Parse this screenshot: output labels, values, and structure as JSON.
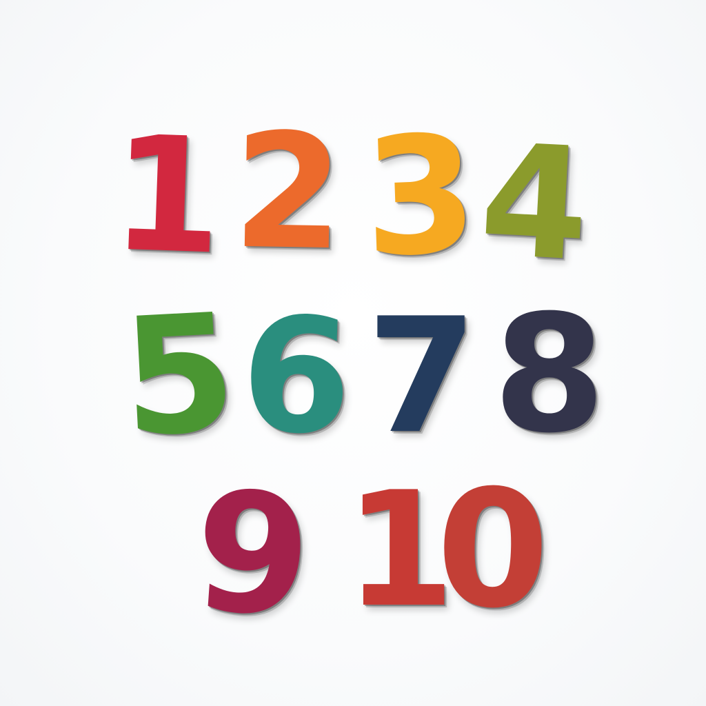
{
  "numbers": [
    {
      "text": "1",
      "color": "#d2283f"
    },
    {
      "text": "2",
      "color": "#ec6a2c"
    },
    {
      "text": "3",
      "color": "#f6a921"
    },
    {
      "text": "4",
      "color": "#8b9b2c"
    },
    {
      "text": "5",
      "color": "#4a9632"
    },
    {
      "text": "6",
      "color": "#2a8e7e"
    },
    {
      "text": "7",
      "color": "#243c5e"
    },
    {
      "text": "8",
      "color": "#33344b"
    },
    {
      "text": "9",
      "color": "#a3214b"
    },
    {
      "text": "1",
      "color": "#c73a34"
    },
    {
      "text": "0",
      "color": "#c33f36"
    }
  ]
}
